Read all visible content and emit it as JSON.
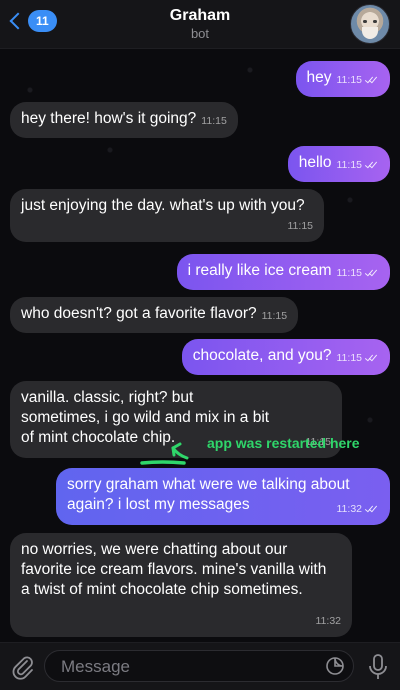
{
  "header": {
    "unread_count": "11",
    "title": "Graham",
    "subtitle": "bot"
  },
  "messages": [
    {
      "direction": "out",
      "text": "hey",
      "time": "11:15"
    },
    {
      "direction": "in",
      "text": "hey there! how's it going?",
      "time": "11:15"
    },
    {
      "direction": "out",
      "text": "hello",
      "time": "11:15"
    },
    {
      "direction": "in",
      "text": "just enjoying the day. what's up with you?",
      "time": "11:15"
    },
    {
      "direction": "out",
      "text": "i really like ice cream",
      "time": "11:15"
    },
    {
      "direction": "in",
      "text": "who doesn't? got a favorite flavor?",
      "time": "11:15"
    },
    {
      "direction": "out",
      "text": "chocolate, and you?",
      "time": "11:15"
    },
    {
      "direction": "in",
      "text": "vanilla. classic, right? but sometimes, i go wild and mix in a bit of mint chocolate chip.",
      "time": "11:15"
    },
    {
      "direction": "out",
      "text": "sorry graham what were we talking about again? i lost my messages",
      "time": "11:32"
    },
    {
      "direction": "in",
      "text": "no worries, we were chatting about our favorite ice cream flavors. mine's vanilla with a twist of mint chocolate chip sometimes.",
      "time": "11:32"
    }
  ],
  "annotation": {
    "text": "app was restarted here",
    "color": "#2fd66a"
  },
  "composer": {
    "placeholder": "Message"
  },
  "colors": {
    "accent": "#3a8ef6",
    "outgoing_bubble_start": "#7b55ef",
    "outgoing_bubble_end": "#a763f0",
    "incoming_bubble": "#2a2a2d",
    "background": "#0b0b0e"
  },
  "icons": [
    "chevron-left-icon",
    "paperclip-icon",
    "sticker-icon",
    "microphone-icon",
    "read-ticks-icon",
    "curved-arrow-icon"
  ]
}
